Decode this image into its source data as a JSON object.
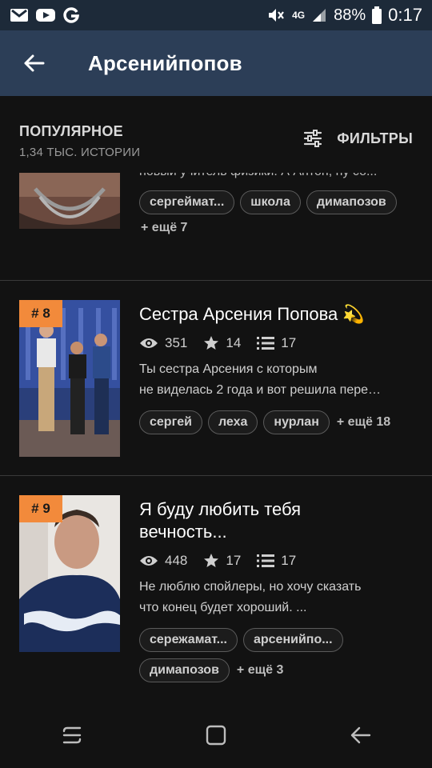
{
  "statusbar": {
    "battery": "88%",
    "time": "0:17",
    "network": "4G"
  },
  "appbar": {
    "title": "Арсенийпопов"
  },
  "section": {
    "title": "ПОПУЛЯРНОЕ",
    "subtitle": "1,34 ТЫС. ИСТОРИИ",
    "filter_label": "ФИЛЬТРЫ"
  },
  "stories": [
    {
      "desc_line": "новый учитель физики. А Антон, ну со...",
      "tags": [
        "сергеймат...",
        "школа",
        "димапозов"
      ],
      "more": "+ ещё 7"
    },
    {
      "rank": "# 8",
      "title": "Сестра Арсения Попова",
      "title_emoji": "💫",
      "views": "351",
      "stars": "14",
      "chapters": "17",
      "desc_line1": "Ты сестра Арсения с которым",
      "desc_line2": "не виделась 2 года и вот решила пере…",
      "tags": [
        "сергей",
        "леха",
        "нурлан"
      ],
      "more": "+ ещё 18"
    },
    {
      "rank": "# 9",
      "title_line1": "Я буду любить тебя",
      "title_line2": "вечность...",
      "views": "448",
      "stars": "17",
      "chapters": "17",
      "desc_line1": "Не люблю спойлеры, но хочу сказать",
      "desc_line2": "что конец будет хороший. ...",
      "tags": [
        "сережамат...",
        "арсенийпо...",
        "димапозов"
      ],
      "more": "+ ещё 3"
    }
  ],
  "colors": {
    "statusbar": "#1d2a39",
    "appbar": "#2c3e57",
    "background": "#121212",
    "rank_badge": "#f28a3b"
  }
}
